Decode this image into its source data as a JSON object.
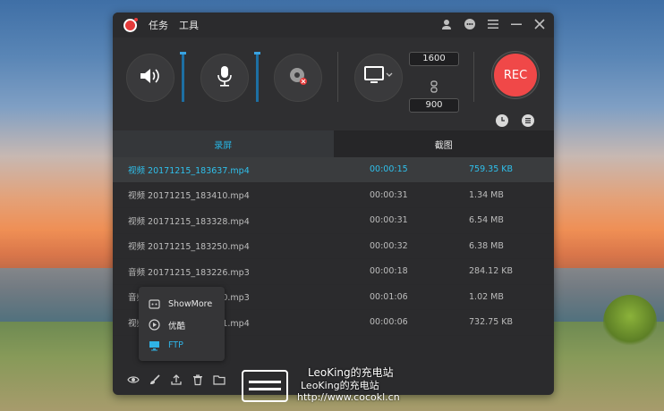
{
  "menu": {
    "task": "任务",
    "tools": "工具"
  },
  "dimensions": {
    "width": "1600",
    "height": "900"
  },
  "rec_label": "REC",
  "tabs": {
    "record": "录屏",
    "screenshot": "截图"
  },
  "files": [
    {
      "name": "视频 20171215_183637.mp4",
      "duration": "00:00:15",
      "size": "759.35 KB"
    },
    {
      "name": "视频 20171215_183410.mp4",
      "duration": "00:00:31",
      "size": "1.34 MB"
    },
    {
      "name": "视频 20171215_183328.mp4",
      "duration": "00:00:31",
      "size": "6.54 MB"
    },
    {
      "name": "视频 20171215_183250.mp4",
      "duration": "00:00:32",
      "size": "6.38 MB"
    },
    {
      "name": "音频 20171215_183226.mp3",
      "duration": "00:00:18",
      "size": "284.12 KB"
    },
    {
      "name": "音频 20171215_183140.mp3",
      "duration": "00:01:06",
      "size": "1.02 MB"
    },
    {
      "name": "视频 20171215_183021.mp4",
      "duration": "00:00:06",
      "size": "732.75 KB"
    }
  ],
  "popup": {
    "showmore": "ShowMore",
    "youku": "优酷",
    "ftp": "FTP"
  },
  "watermark": {
    "line1": "LeoKing的充电站",
    "line2": "LeoKing的充电站",
    "line3": "http://www.cocokl.cn"
  },
  "colors": {
    "accent": "#27b6e5",
    "rec": "#f04848",
    "level": "#1d6fa3"
  },
  "icons": {
    "speaker": "speaker-icon",
    "mic": "microphone-icon",
    "webcam": "webcam-icon",
    "monitor": "monitor-icon",
    "link": "link-icon",
    "clock": "clock-icon",
    "settings": "settings-icon",
    "eye": "eye-icon",
    "brush": "brush-icon",
    "upload": "upload-icon",
    "trash": "trash-icon",
    "folder": "folder-icon"
  }
}
